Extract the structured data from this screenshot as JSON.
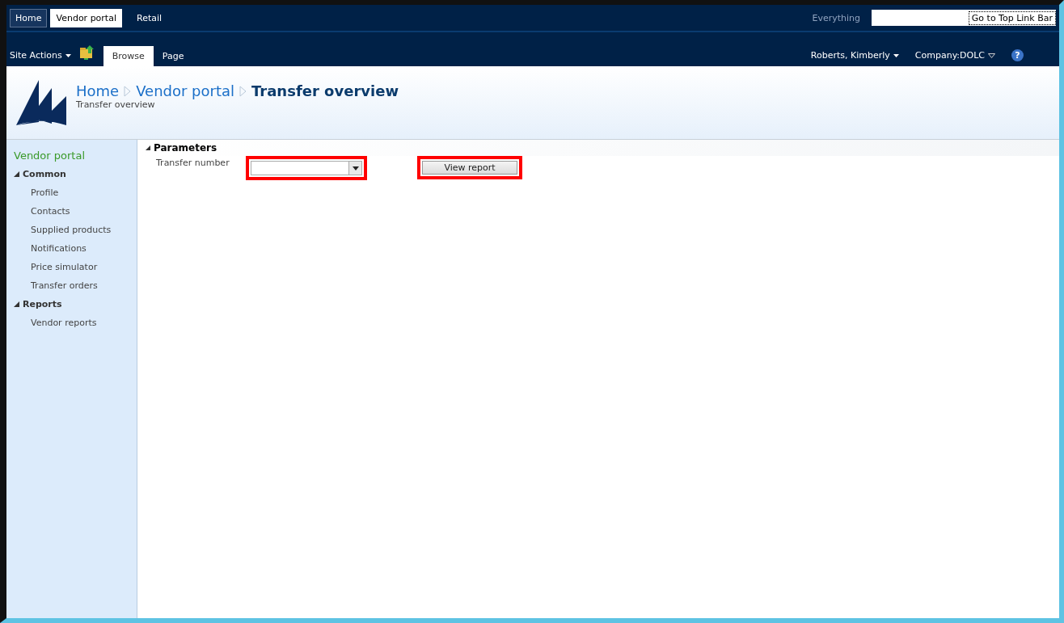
{
  "top_link_bar": [
    {
      "label": "Home",
      "selected": false,
      "kind": "boxed"
    },
    {
      "label": "Vendor portal",
      "selected": true,
      "kind": "boxed"
    },
    {
      "label": "Retail",
      "selected": false,
      "kind": "plain"
    }
  ],
  "search": {
    "scope": "Everything",
    "skip_link": "Go to Top Link Bar"
  },
  "ribbon": {
    "site_actions": "Site Actions",
    "tabs": [
      {
        "label": "Browse",
        "selected": true
      },
      {
        "label": "Page",
        "selected": false
      }
    ],
    "user": "Roberts, Kimberly",
    "company": "Company:DOLC",
    "help": "?"
  },
  "header": {
    "breadcrumb": [
      {
        "label": "Home",
        "current": false
      },
      {
        "label": "Vendor portal",
        "current": false
      },
      {
        "label": "Transfer overview",
        "current": true
      }
    ],
    "subtitle": "Transfer overview"
  },
  "sidebar": {
    "title": "Vendor portal",
    "groups": [
      {
        "label": "Common",
        "expanded": true,
        "items": [
          "Profile",
          "Contacts",
          "Supplied products",
          "Notifications",
          "Price simulator",
          "Transfer orders"
        ]
      },
      {
        "label": "Reports",
        "expanded": true,
        "items": [
          "Vendor reports"
        ]
      }
    ]
  },
  "parameters": {
    "title": "Parameters",
    "expanded": true,
    "field_label": "Transfer number",
    "field_highlighted": true,
    "button": "View report",
    "button_highlighted": true
  }
}
